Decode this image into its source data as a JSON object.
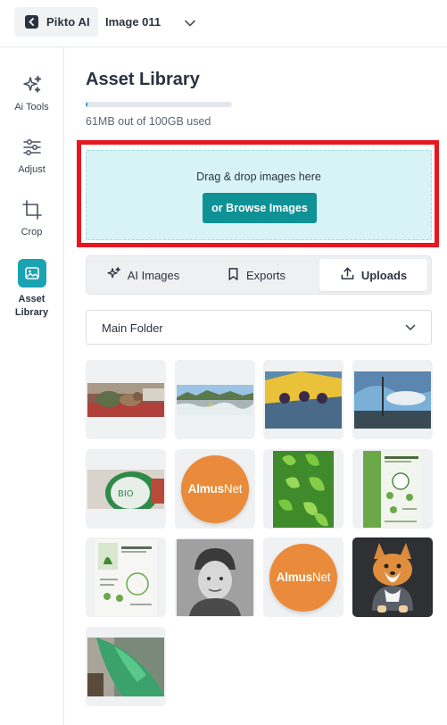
{
  "topbar": {
    "brand": "Pikto AI",
    "document_title": "Image 011"
  },
  "rail": {
    "items": [
      {
        "label": "Ai Tools",
        "icon": "sparkle-icon"
      },
      {
        "label": "Adjust",
        "icon": "sliders-icon"
      },
      {
        "label": "Crop",
        "icon": "crop-icon"
      },
      {
        "label": "Asset\nLibrary",
        "label_line1": "Asset",
        "label_line2": "Library",
        "icon": "image-library-icon",
        "active": true
      }
    ]
  },
  "main": {
    "title": "Asset Library",
    "usage": {
      "text": "61MB out of 100GB used",
      "fraction": 0.0006
    },
    "dropzone": {
      "text": "Drag & drop images here",
      "browse_label": "or Browse Images"
    },
    "tabs": [
      {
        "label": "AI Images",
        "icon": "ai-sparkle-icon",
        "active": false
      },
      {
        "label": "Exports",
        "icon": "bookmark-icon",
        "active": false
      },
      {
        "label": "Uploads",
        "icon": "upload-icon",
        "active": true
      }
    ],
    "folder_select": {
      "value": "Main Folder"
    },
    "thumbnails": [
      {
        "kind": "photo",
        "subject": "cat on patterned rug"
      },
      {
        "kind": "photo",
        "subject": "river rapids with mountains"
      },
      {
        "kind": "photo",
        "subject": "yellow rafts on river"
      },
      {
        "kind": "photo",
        "subject": "sky over lake with pole"
      },
      {
        "kind": "photo",
        "subject": "green can close-up"
      },
      {
        "kind": "logo",
        "text_bold": "Almus",
        "text_light": "Net"
      },
      {
        "kind": "photo",
        "subject": "green leaves pattern"
      },
      {
        "kind": "document",
        "subject": "photosynthesis process poster"
      },
      {
        "kind": "document",
        "subject": "photosynthesis process diagram"
      },
      {
        "kind": "photo",
        "subject": "black and white child portrait"
      },
      {
        "kind": "logo",
        "text_bold": "Almus",
        "text_light": "Net"
      },
      {
        "kind": "photo",
        "subject": "corgi dog 3d render"
      },
      {
        "kind": "photo",
        "subject": "green fabric indoor"
      }
    ]
  },
  "colors": {
    "accent": "#1aa3b3",
    "button": "#0f9296",
    "dropzone_bg": "#d8f3f5",
    "highlight_frame": "#e8161f",
    "logo_orange": "#e98b3a"
  }
}
